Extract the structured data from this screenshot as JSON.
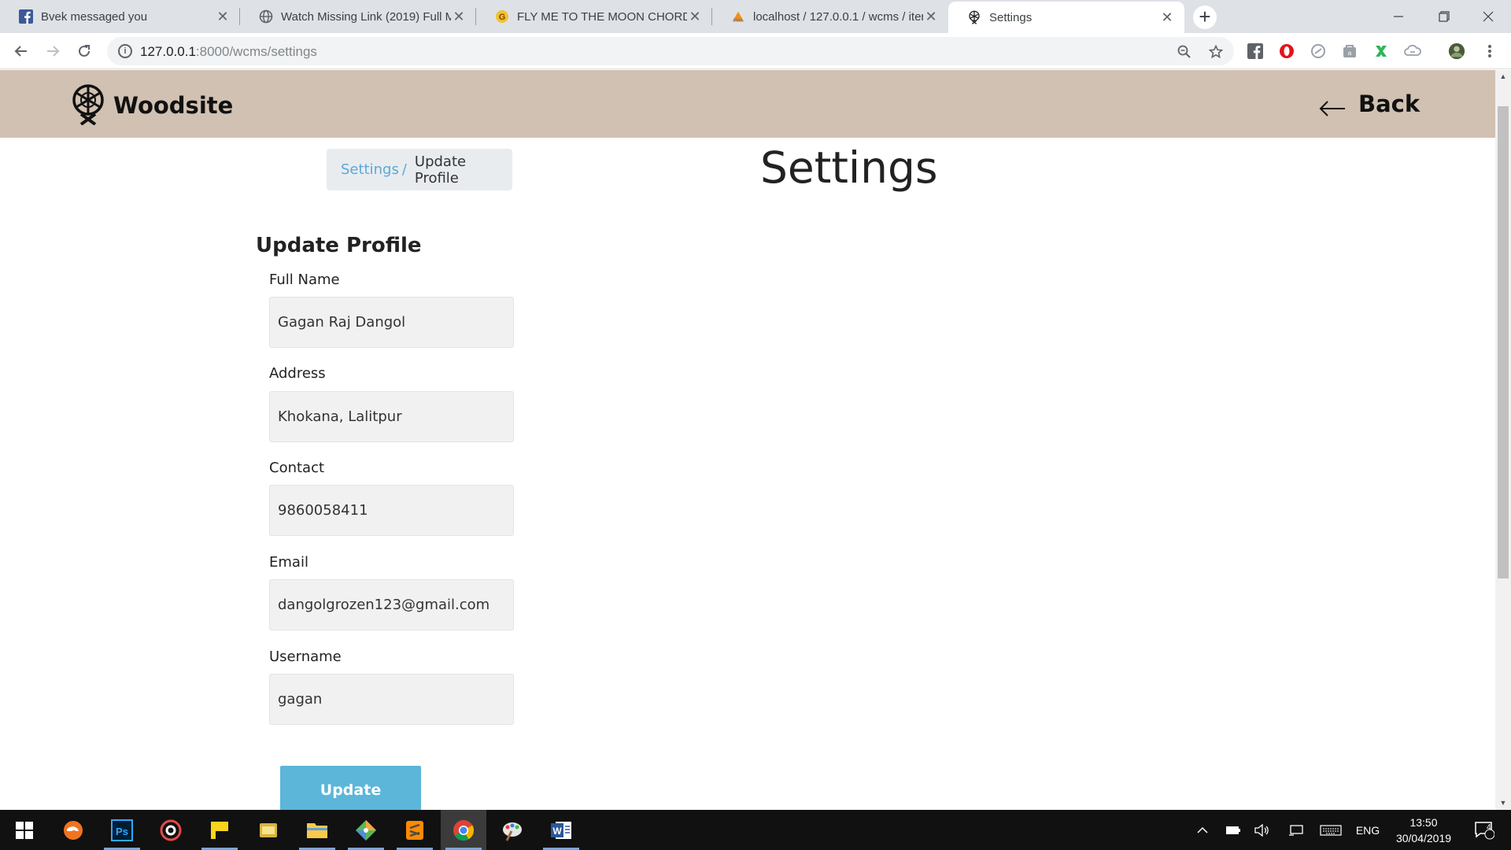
{
  "browser": {
    "tabs": [
      {
        "title": "Bvek messaged you",
        "icon": "facebook-icon"
      },
      {
        "title": "Watch Missing Link (2019) Full M",
        "icon": "globe-icon"
      },
      {
        "title": "FLY ME TO THE MOON CHORDS",
        "icon": "chords-site-icon"
      },
      {
        "title": "localhost / 127.0.0.1 / wcms / iter",
        "icon": "phpmyadmin-icon"
      },
      {
        "title": "Settings",
        "icon": "woodsite-favicon",
        "active": true
      }
    ],
    "close_glyph": "✕",
    "new_tab_glyph": "+",
    "url_host": "127.0.0.1",
    "url_rest": ":8000/wcms/settings"
  },
  "header": {
    "brand": "Woodsite",
    "back_label": "Back",
    "background": "#d1c1b2"
  },
  "breadcrumb": {
    "parent": "Settings",
    "separator": "/",
    "current": "Update Profile"
  },
  "page": {
    "title": "Settings"
  },
  "form": {
    "title": "Update Profile",
    "fields": [
      {
        "label": "Full Name",
        "value": "Gagan Raj Dangol"
      },
      {
        "label": "Address",
        "value": "Khokana, Lalitpur"
      },
      {
        "label": "Contact",
        "value": "9860058411"
      },
      {
        "label": "Email",
        "value": "dangolgrozen123@gmail.com"
      },
      {
        "label": "Username",
        "value": "gagan"
      }
    ],
    "submit_label": "Update",
    "button_color": "#5bb6d9"
  },
  "taskbar": {
    "time": "13:50",
    "date": "30/04/2019",
    "language": "ENG",
    "notification_count": "4"
  }
}
